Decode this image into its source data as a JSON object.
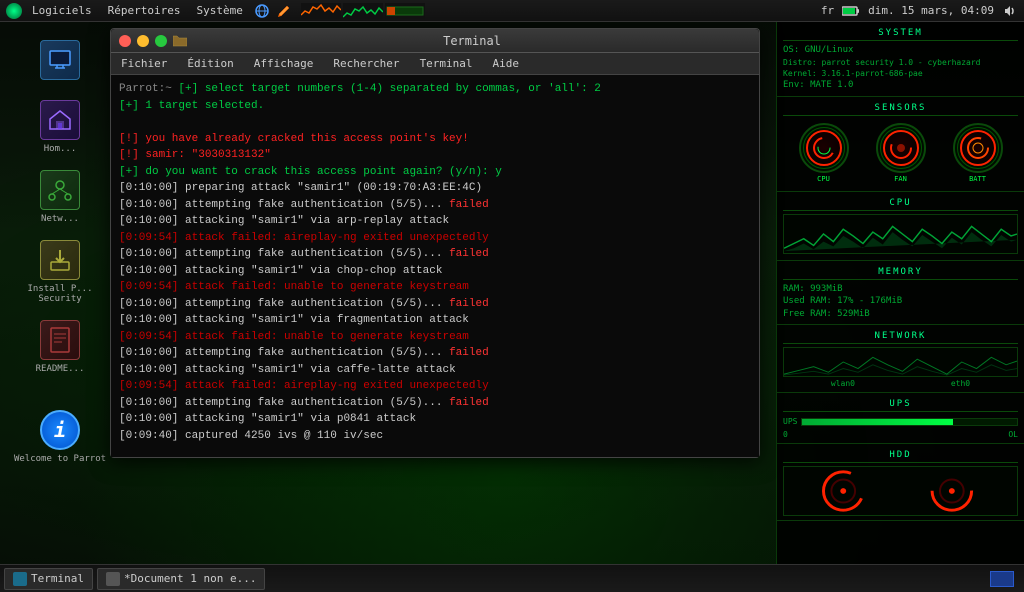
{
  "taskbar_top": {
    "app_menus": [
      "Logiciels",
      "Répertoires",
      "Système"
    ],
    "right_info": {
      "lang": "fr",
      "datetime": "dim. 15 mars, 04:09"
    }
  },
  "sidebar": {
    "items": [
      {
        "id": "monitor",
        "label": ""
      },
      {
        "id": "home",
        "label": "Hom..."
      },
      {
        "id": "network",
        "label": "Netw..."
      },
      {
        "id": "install",
        "label": "Install P... Security"
      },
      {
        "id": "readme",
        "label": "README..."
      },
      {
        "id": "info",
        "label": "Welcome to Parrot",
        "symbol": "i"
      }
    ]
  },
  "terminal": {
    "title": "Terminal",
    "menu_items": [
      "Fichier",
      "Édition",
      "Affichage",
      "Rechercher",
      "Terminal",
      "Aide"
    ],
    "lines": [
      {
        "prefix": "[+]",
        "text": " select target numbers (1-4) separated by commas, or 'all': 2",
        "color": "green"
      },
      {
        "prefix": "[+]",
        "text": " 1 target selected.",
        "color": "green"
      },
      {
        "prefix": "[!]",
        "text": " you have already cracked this access point's key!",
        "color": "red"
      },
      {
        "prefix": "[!]",
        "text": " samir: \"3030313132\"",
        "color": "red"
      },
      {
        "prefix": "[+]",
        "text": " do you want to crack this access point again? (y/n): y",
        "color": "green"
      },
      {
        "prefix": "[0:10:00]",
        "text": " preparing attack \"samir1\" (00:19:70:A3:EE:4C)",
        "color": "white"
      },
      {
        "prefix": "[0:10:00]",
        "text": " attempting fake authentication (5/5)...",
        "suffix": " failed",
        "color": "white",
        "suffix_color": "red"
      },
      {
        "prefix": "[0:10:00]",
        "text": " attacking \"samir1\" via arp-replay attack",
        "color": "white"
      },
      {
        "prefix": "[0:09:54]",
        "text": " attack failed: aireplay-ng exited unexpectedly",
        "color": "dark-red"
      },
      {
        "prefix": "[0:10:00]",
        "text": " attempting fake authentication (5/5)...",
        "suffix": " failed",
        "color": "white",
        "suffix_color": "red"
      },
      {
        "prefix": "[0:10:00]",
        "text": " attacking \"samir1\" via chop-chop attack",
        "color": "white"
      },
      {
        "prefix": "[0:09:54]",
        "text": " attack failed: unable to generate keystream",
        "color": "dark-red"
      },
      {
        "prefix": "[0:10:00]",
        "text": " attempting fake authentication (5/5)...",
        "suffix": " failed",
        "color": "white",
        "suffix_color": "red"
      },
      {
        "prefix": "[0:10:00]",
        "text": " attacking \"samir1\" via fragmentation attack",
        "color": "white"
      },
      {
        "prefix": "[0:09:54]",
        "text": " attack failed: unable to generate keystream",
        "color": "dark-red"
      },
      {
        "prefix": "[0:10:00]",
        "text": " attempting fake authentication (5/5)...",
        "suffix": " failed",
        "color": "white",
        "suffix_color": "red"
      },
      {
        "prefix": "[0:10:00]",
        "text": " attacking \"samir1\" via caffe-latte attack",
        "color": "white"
      },
      {
        "prefix": "[0:09:54]",
        "text": " attack failed: aireplay-ng exited unexpectedly",
        "color": "dark-red"
      },
      {
        "prefix": "[0:10:00]",
        "text": " attempting fake authentication (5/5)...",
        "suffix": " failed",
        "color": "white",
        "suffix_color": "red"
      },
      {
        "prefix": "[0:10:00]",
        "text": " attacking \"samir1\" via p0841 attack",
        "color": "white"
      },
      {
        "prefix": "[0:09:40]",
        "text": " captured 4250 ivs @ 110 iv/sec",
        "color": "white"
      }
    ]
  },
  "sysmon": {
    "sections": {
      "system": {
        "title": "SYSTEM",
        "rows": [
          "OS: GNU/Linux",
          "Distro: parrot security 1.0 - cyberhazard",
          "Kernel: 3.16.1-parrot-686-pae",
          "Env: MATE 1.0"
        ]
      },
      "sensors": {
        "title": "SENSORS",
        "gauges": [
          "CPU",
          "FAN",
          "BATT"
        ]
      },
      "cpu": {
        "title": "CPU"
      },
      "memory": {
        "title": "MEMORY",
        "rows": [
          "RAM: 993MiB",
          "Used RAM: 17% - 176MiB",
          "Free RAM: 529MiB"
        ]
      },
      "network": {
        "title": "NETWORK",
        "labels": [
          "wlan0",
          "eth0"
        ]
      },
      "ups": {
        "title": "UPS"
      },
      "hdd": {
        "title": "HDD"
      }
    }
  },
  "taskbar_bottom": {
    "items": [
      {
        "label": "Terminal",
        "active": true
      },
      {
        "label": "*Document 1 non e...",
        "active": false
      }
    ]
  }
}
